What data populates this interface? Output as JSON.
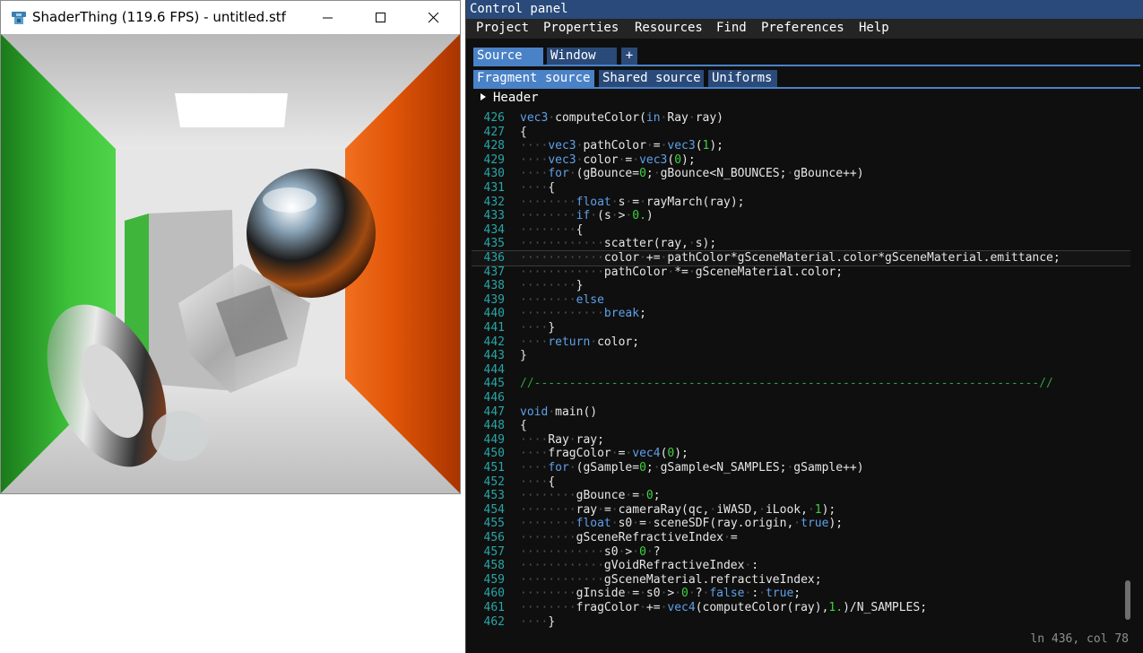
{
  "app_window": {
    "title": "ShaderThing (119.6 FPS) - untitled.stf",
    "buttons": {
      "minimize": "minimize",
      "maximize": "maximize",
      "close": "close"
    }
  },
  "panel": {
    "title": "Control panel",
    "menu": [
      "Project",
      "Properties",
      "Resources",
      "Find",
      "Preferences",
      "Help"
    ],
    "tabs": [
      "Source",
      "Window",
      "+"
    ],
    "subtabs": [
      "Fragment source",
      "Shared source",
      "Uniforms"
    ],
    "header_label": "Header",
    "status": "ln 436, col 78"
  },
  "editor": {
    "cursor_line": 436,
    "lines": [
      {
        "no": "426",
        "text": "vec3 computeColor(in Ray ray)"
      },
      {
        "no": "427",
        "text": "{"
      },
      {
        "no": "428",
        "text": "····vec3 pathColor = vec3(1);"
      },
      {
        "no": "429",
        "text": "····vec3 color = vec3(0);"
      },
      {
        "no": "430",
        "text": "····for (gBounce=0; gBounce<N_BOUNCES; gBounce++)"
      },
      {
        "no": "431",
        "text": "····{"
      },
      {
        "no": "432",
        "text": "········float s = rayMarch(ray);"
      },
      {
        "no": "433",
        "text": "········if (s > 0.)"
      },
      {
        "no": "434",
        "text": "········{"
      },
      {
        "no": "435",
        "text": "············scatter(ray, s);"
      },
      {
        "no": "436",
        "text": "············color += pathColor*gSceneMaterial.color*gSceneMaterial.emittance;"
      },
      {
        "no": "437",
        "text": "············pathColor *= gSceneMaterial.color;"
      },
      {
        "no": "438",
        "text": "········}"
      },
      {
        "no": "439",
        "text": "········else"
      },
      {
        "no": "440",
        "text": "············break;"
      },
      {
        "no": "441",
        "text": "····}"
      },
      {
        "no": "442",
        "text": "····return color;"
      },
      {
        "no": "443",
        "text": "}"
      },
      {
        "no": "444",
        "text": ""
      },
      {
        "no": "445",
        "text": "//------------------------------------------------------------------------//"
      },
      {
        "no": "446",
        "text": ""
      },
      {
        "no": "447",
        "text": "void main()"
      },
      {
        "no": "448",
        "text": "{"
      },
      {
        "no": "449",
        "text": "····Ray ray;"
      },
      {
        "no": "450",
        "text": "····fragColor = vec4(0);"
      },
      {
        "no": "451",
        "text": "····for (gSample=0; gSample<N_SAMPLES; gSample++)"
      },
      {
        "no": "452",
        "text": "····{"
      },
      {
        "no": "453",
        "text": "········gBounce = 0;"
      },
      {
        "no": "454",
        "text": "········ray = cameraRay(qc, iWASD, iLook, 1);"
      },
      {
        "no": "455",
        "text": "········float s0 = sceneSDF(ray.origin, true);"
      },
      {
        "no": "456",
        "text": "········gSceneRefractiveIndex ="
      },
      {
        "no": "457",
        "text": "············s0 > 0 ?"
      },
      {
        "no": "458",
        "text": "············gVoidRefractiveIndex :"
      },
      {
        "no": "459",
        "text": "············gSceneMaterial.refractiveIndex;"
      },
      {
        "no": "460",
        "text": "········gInside = s0 > 0 ? false : true;"
      },
      {
        "no": "461",
        "text": "········fragColor += vec4(computeColor(ray),1.)/N_SAMPLES;"
      },
      {
        "no": "462",
        "text": "····}"
      }
    ]
  },
  "icons": {
    "app": "shaderthing-logo-icon",
    "header_toggle": "triangle-right-icon"
  },
  "colors": {
    "panel_bg": "#0f0f0f",
    "title_bar": "#294a7a",
    "tab_active": "#4a82c8",
    "tab_inactive": "#2a4a7a",
    "line_numbers": "#28a6a6",
    "keyword": "#5ea0e8",
    "number": "#40d040",
    "comment": "#2ea043"
  }
}
